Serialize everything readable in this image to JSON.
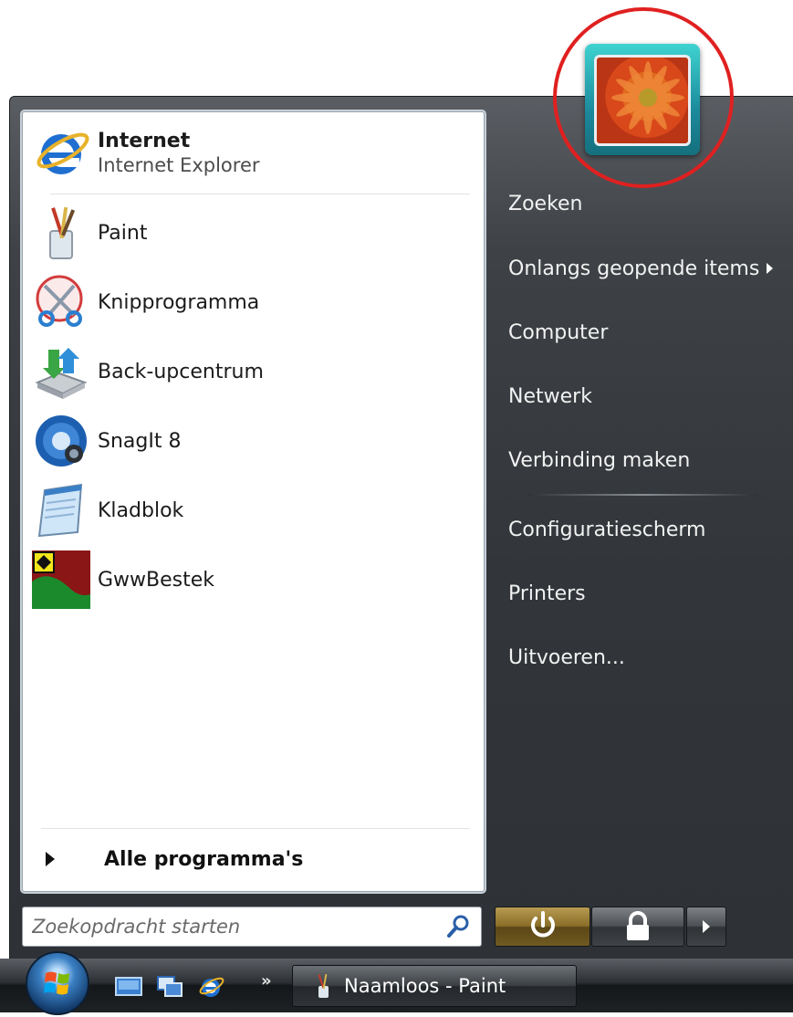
{
  "pinned": {
    "name": "Internet",
    "sub": "Internet Explorer"
  },
  "programs": [
    {
      "label": "Paint",
      "icon": "paint-icon"
    },
    {
      "label": "Knipprogramma",
      "icon": "snipping-tool-icon"
    },
    {
      "label": "Back-upcentrum",
      "icon": "backup-center-icon"
    },
    {
      "label": "SnagIt 8",
      "icon": "snagit-icon"
    },
    {
      "label": "Kladblok",
      "icon": "notepad-icon"
    },
    {
      "label": "GwwBestek",
      "icon": "gwwbestek-icon"
    }
  ],
  "all_programs": "Alle programma's",
  "right_items": [
    {
      "label": "Zoeken"
    },
    {
      "label": "Onlangs geopende items",
      "has_submenu": true
    },
    {
      "label": "Computer"
    },
    {
      "label": "Netwerk"
    },
    {
      "label": "Verbinding maken"
    },
    {
      "label": "Configuratiescherm"
    },
    {
      "label": "Printers"
    },
    {
      "label": "Uitvoeren..."
    }
  ],
  "search": {
    "placeholder": "Zoekopdracht starten"
  },
  "taskbar": {
    "window_button": "Naamloos - Paint",
    "quicklaunch_more": "»"
  },
  "colors": {
    "accent_circle": "#e02020",
    "panel_dark": "#32363a",
    "power_button": "#8a6e28"
  }
}
